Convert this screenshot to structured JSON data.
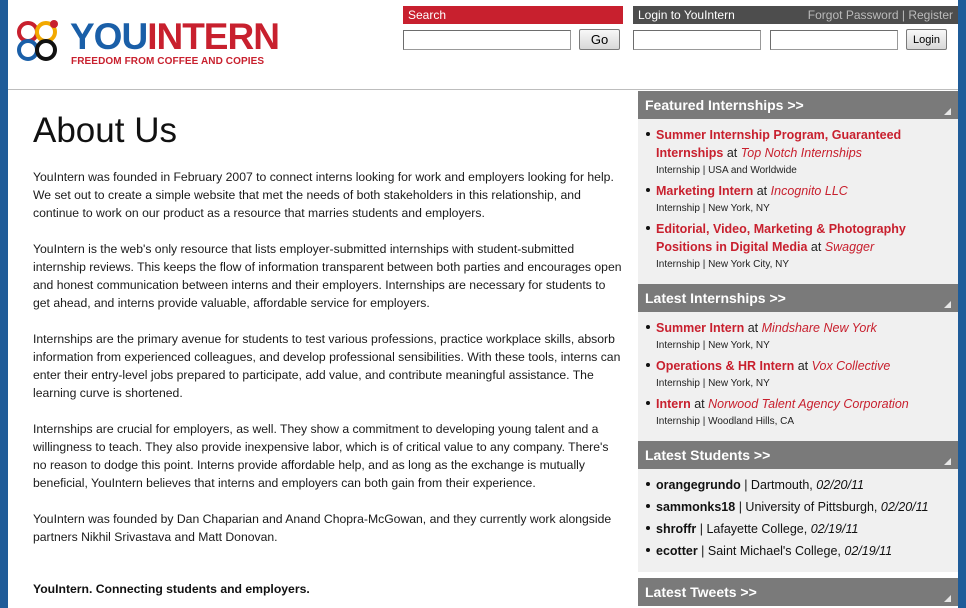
{
  "header": {
    "logo_main": "YOU",
    "logo_accent": "INTERN",
    "logo_tagline": "FREEDOM FROM COFFEE AND COPIES",
    "search_label": "Search",
    "go_label": "Go",
    "login_title": "Login to YouIntern",
    "forgot_password": "Forgot Password",
    "separator": "|",
    "register": "Register",
    "login_button": "Login"
  },
  "main": {
    "title": "About Us",
    "paragraphs": [
      "YouIntern was founded in February 2007 to connect interns looking for work and employers looking for help. We set out to create a simple website that met the needs of both stakeholders in this relationship, and continue to work on our product as a resource that marries students and employers.",
      "YouIntern is the web's only resource that lists employer-submitted internships with student-submitted internship reviews. This keeps the flow of information transparent between both parties and encourages open and honest communication between interns and their employers. Internships are necessary for students to get ahead, and interns provide valuable, affordable service for employers.",
      "Internships are the primary avenue for students to test various professions, practice workplace skills, absorb information from experienced colleagues, and develop professional sensibilities. With these tools, interns can enter their entry-level jobs prepared to participate, add value, and contribute meaningful assistance. The learning curve is shortened.",
      "Internships are crucial for employers, as well. They show a commitment to developing young talent and a willingness to teach. They also provide inexpensive labor, which is of critical value to any company. There's no reason to dodge this point. Interns provide affordable help, and as long as the exchange is mutually beneficial, YouIntern believes that interns and employers can both gain from their experience.",
      "YouIntern was founded by Dan Chaparian and Anand Chopra-McGowan, and they currently work alongside partners Nikhil Srivastava and Matt Donovan."
    ],
    "tagline": "YouIntern. Connecting students and employers."
  },
  "sidebar": {
    "featured_heading": "Featured Internships >>",
    "featured": [
      {
        "title": "Summer Internship Program, Guaranteed Internships",
        "at": "at",
        "company": "Top Notch Internships",
        "meta": "Internship | USA and Worldwide"
      },
      {
        "title": "Marketing Intern",
        "at": "at",
        "company": "Incognito LLC",
        "meta": "Internship | New York, NY"
      },
      {
        "title": "Editorial, Video, Marketing & Photography Positions in Digital Media",
        "at": "at",
        "company": "Swagger",
        "meta": "Internship | New York City, NY"
      }
    ],
    "latest_heading": "Latest Internships >>",
    "latest": [
      {
        "title": "Summer Intern",
        "at": "at",
        "company": "Mindshare New York",
        "meta": "Internship | New York, NY"
      },
      {
        "title": "Operations & HR Intern",
        "at": "at",
        "company": "Vox Collective",
        "meta": "Internship | New York, NY"
      },
      {
        "title": "Intern",
        "at": "at",
        "company": "Norwood Talent Agency Corporation",
        "meta": "Internship | Woodland Hills, CA"
      }
    ],
    "students_heading": "Latest Students >>",
    "students": [
      {
        "name": "orangegrundo",
        "school": " | Dartmouth, ",
        "date": "02/20/11"
      },
      {
        "name": "sammonks18",
        "school": " | University of Pittsburgh, ",
        "date": "02/20/11"
      },
      {
        "name": "shroffr",
        "school": " | Lafayette College, ",
        "date": "02/19/11"
      },
      {
        "name": "ecotter",
        "school": " | Saint Michael's College, ",
        "date": "02/19/11"
      }
    ],
    "tweets_heading": "Latest Tweets >>"
  },
  "colors": {
    "brand_red": "#c8202e",
    "brand_blue": "#1a5fa8",
    "frame_blue": "#1f5c99",
    "sidebar_gray": "#7a7a7a"
  }
}
